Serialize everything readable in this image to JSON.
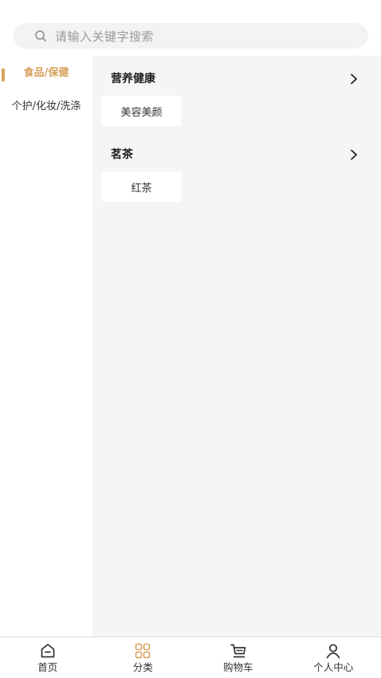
{
  "search": {
    "placeholder": "请输入关键字搜索",
    "icon": "search-icon"
  },
  "sidebar": {
    "items": [
      {
        "label": "食品/保健",
        "active": true
      },
      {
        "label": "个护/化妆/洗涤",
        "active": false
      }
    ]
  },
  "content": {
    "sections": [
      {
        "title": "营养健康",
        "items": [
          "美容美颜"
        ]
      },
      {
        "title": "茗茶",
        "items": [
          "红茶"
        ]
      }
    ]
  },
  "tabbar": {
    "tabs": [
      {
        "label": "首页",
        "icon": "home-icon",
        "active": false
      },
      {
        "label": "分类",
        "icon": "grid-icon",
        "active": true
      },
      {
        "label": "购物车",
        "icon": "cart-icon",
        "active": false
      },
      {
        "label": "个人中心",
        "icon": "user-icon",
        "active": false
      }
    ]
  },
  "colors": {
    "accent": "#d7a15c",
    "content_bg": "#f5f5f5",
    "search_bg": "#f3f3f3"
  }
}
